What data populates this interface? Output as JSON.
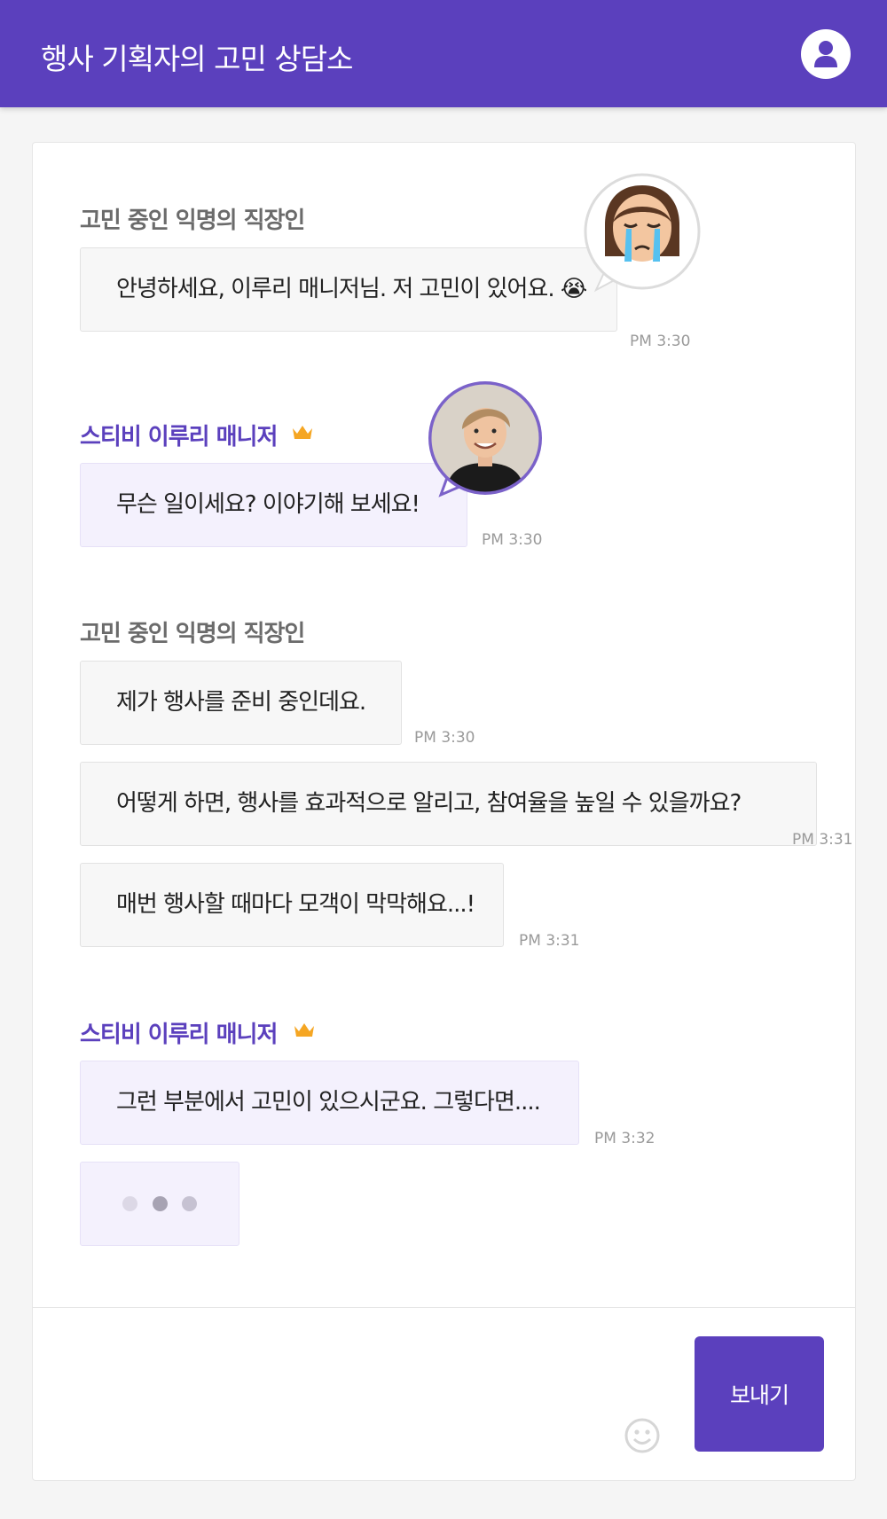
{
  "header": {
    "title": "행사 기획자의 고민 상담소",
    "profile_icon": "user-profile-icon"
  },
  "messages": [
    {
      "sender": "고민 중인 익명의 직장인",
      "role": "customer",
      "avatar": "crying-face-icon",
      "bubbles": [
        {
          "text": "안녕하세요, 이루리 매니저님. 저 고민이 있어요. 😭",
          "time": "PM 3:30"
        }
      ]
    },
    {
      "sender": "스티비 이루리 매니저",
      "role": "manager",
      "badge": "crown-icon",
      "avatar": "manager-photo",
      "bubbles": [
        {
          "text": "무슨 일이세요? 이야기해 보세요!",
          "time": "PM 3:30"
        }
      ]
    },
    {
      "sender": "고민 중인 익명의 직장인",
      "role": "customer",
      "bubbles": [
        {
          "text": "제가 행사를 준비 중인데요.",
          "time": "PM 3:30"
        },
        {
          "text": "어떻게 하면, 행사를 효과적으로 알리고, 참여율을 높일 수 있을까요?",
          "time": "PM 3:31"
        },
        {
          "text": "매번 행사할 때마다 모객이 막막해요...!",
          "time": "PM 3:31"
        }
      ]
    },
    {
      "sender": "스티비 이루리 매니저",
      "role": "manager",
      "badge": "crown-icon",
      "bubbles": [
        {
          "text": "그런 부분에서 고민이 있으시군요. 그렇다면....",
          "time": "PM 3:32"
        }
      ],
      "typing_indicator": true
    }
  ],
  "composer": {
    "emoji_icon": "smiley-face-icon",
    "send_label": "보내기"
  },
  "colors": {
    "brand": "#5b40bd",
    "manager_bubble": "#f4f1fd",
    "customer_bubble": "#f7f7f7",
    "crown": "#f5a623"
  }
}
